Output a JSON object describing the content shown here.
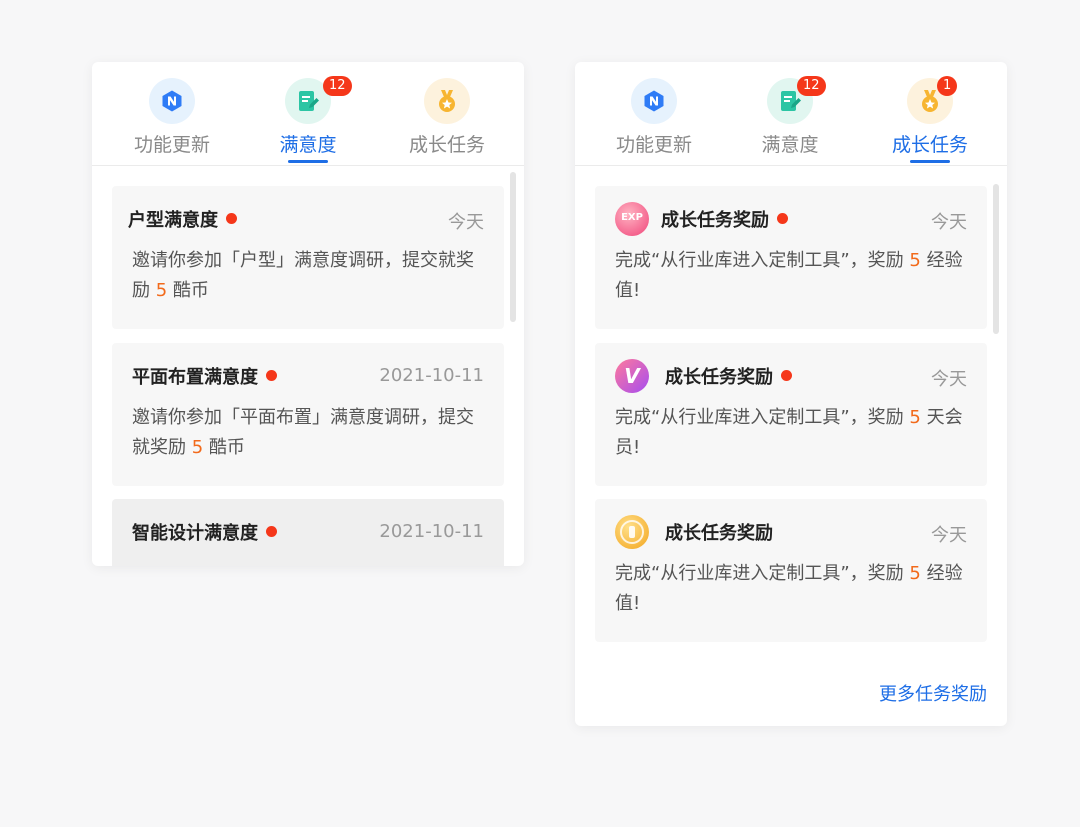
{
  "tabs": {
    "update": "功能更新",
    "satisfaction": "满意度",
    "growth": "成长任务"
  },
  "left_panel": {
    "satisfaction_badge": "12",
    "active_tab": "满意度",
    "cards": [
      {
        "title": "户型满意度",
        "date": "今天",
        "body_pre": "邀请你参加「户型」满意度调研，提交就奖励",
        "reward": "5",
        "body_post": "酷币"
      },
      {
        "title": "平面布置满意度",
        "date": "2021-10-11",
        "body_pre": "邀请你参加「平面布置」满意度调研，提交就奖励",
        "reward": "5",
        "body_post": "酷币"
      },
      {
        "title": "智能设计满意度",
        "date": "2021-10-11"
      }
    ]
  },
  "right_panel": {
    "satisfaction_badge": "12",
    "growth_badge": "1",
    "active_tab": "成长任务",
    "cards": [
      {
        "icon": "exp-icon",
        "icon_text": "EXP",
        "title": "成长任务奖励",
        "date": "今天",
        "body_pre": "完成“从行业库进入定制工具”，奖励",
        "reward": "5",
        "body_post": "经验值!"
      },
      {
        "icon": "vip-icon",
        "icon_text": "V",
        "title": "成长任务奖励",
        "date": "今天",
        "body_pre": "完成“从行业库进入定制工具”，奖励",
        "reward": "5",
        "body_post": "天会员!"
      },
      {
        "icon": "coin-icon",
        "title": "成长任务奖励",
        "date": "今天",
        "body_pre": "完成“从行业库进入定制工具”，奖励",
        "reward": "5",
        "body_post": "经验值!"
      }
    ],
    "more_link": "更多任务奖励"
  },
  "colors": {
    "accent": "#1e6ee6",
    "badge": "#f5371a",
    "reward": "#f26a1b"
  }
}
